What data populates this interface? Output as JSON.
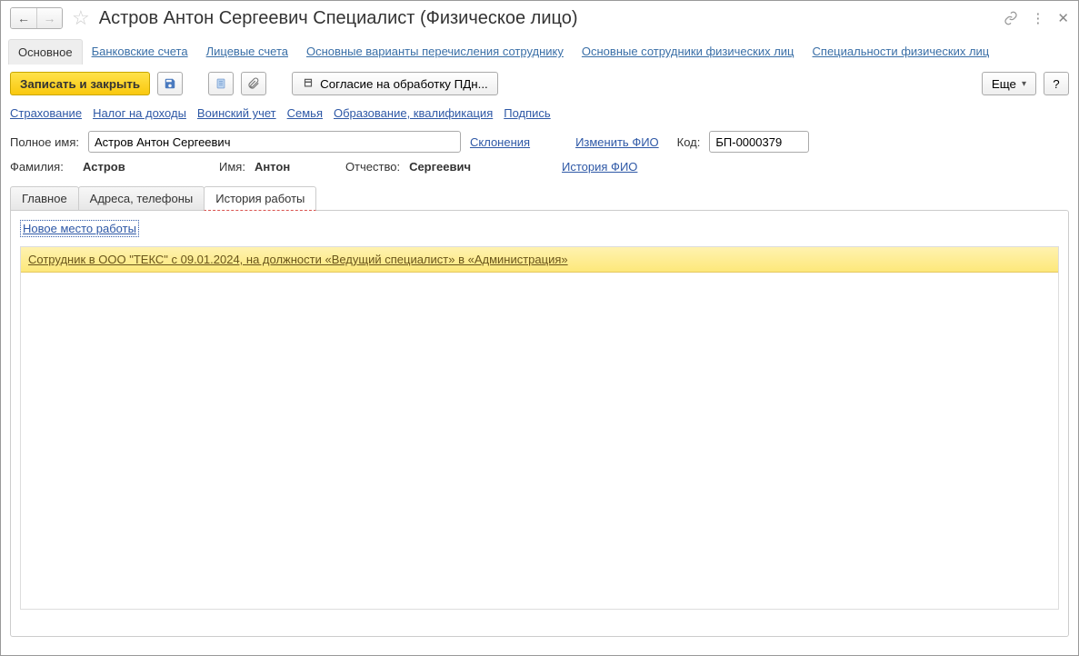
{
  "title": "Астров Антон Сергеевич Специалист (Физическое лицо)",
  "sectionTabs": {
    "active": "Основное",
    "items": [
      "Банковские счета",
      "Лицевые счета",
      "Основные варианты перечисления сотруднику",
      "Основные сотрудники физических лиц",
      "Специальности физических лиц"
    ]
  },
  "toolbar": {
    "saveClose": "Записать и закрыть",
    "pdnConsent": "Согласие на обработку ПДн...",
    "more": "Еще",
    "help": "?"
  },
  "sublinks": [
    "Страхование",
    "Налог на доходы",
    "Воинский учет",
    "Семья",
    "Образование, квалификация",
    "Подпись"
  ],
  "fullNameLabel": "Полное имя:",
  "fullName": "Астров Антон Сергеевич",
  "declensions": "Склонения",
  "changeFio": "Изменить ФИО",
  "codeLabel": "Код:",
  "code": "БП-0000379",
  "surnameLabel": "Фамилия:",
  "surname": "Астров",
  "nameLabel": "Имя:",
  "name": "Антон",
  "patronymicLabel": "Отчество:",
  "patronymic": "Сергеевич",
  "historyFio": "История ФИО",
  "tabs2": {
    "main": "Главное",
    "addr": "Адреса, телефоны",
    "history": "История работы"
  },
  "newJob": "Новое место работы",
  "jobRow": "Сотрудник в ООО \"ТЕКС\" с 09.01.2024, на должности «Ведущий специалист» в «Администрация»"
}
